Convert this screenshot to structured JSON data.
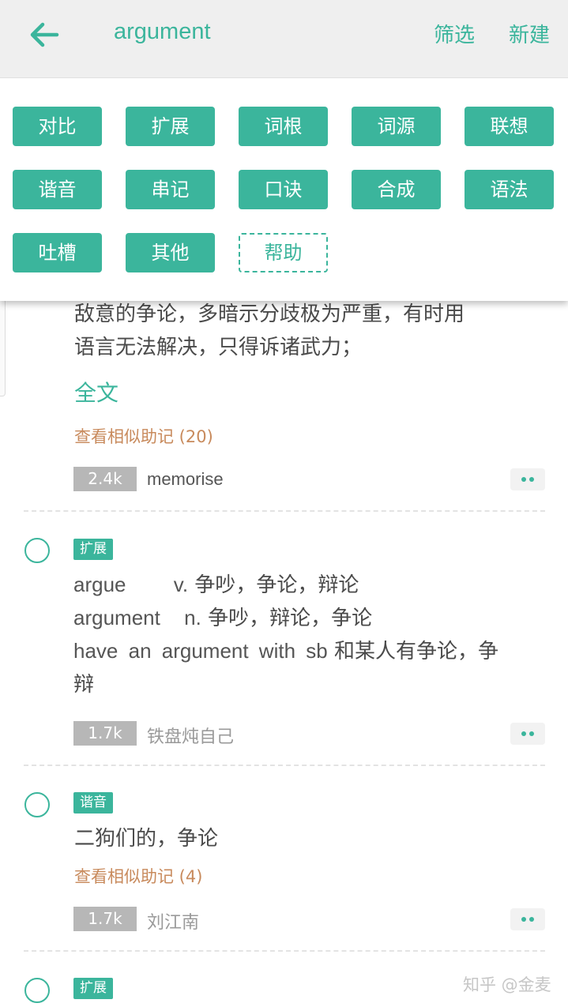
{
  "header": {
    "title": "argument",
    "filter_label": "筛选",
    "new_label": "新建",
    "back_icon": "arrow-left-icon"
  },
  "tag_popup": {
    "tags": [
      "对比",
      "扩展",
      "词根",
      "词源",
      "联想",
      "谐音",
      "串记",
      "口诀",
      "合成",
      "语法",
      "吐槽",
      "其他"
    ],
    "help_label": "帮助"
  },
  "entries": [
    {
      "lines": [
        "敌意的争论，多暗示分歧极为严重，有时用",
        "语言无法解决，只得诉诸武力；"
      ],
      "full_text_label": "全文",
      "similar_label": "查看相似助记 (20)",
      "count": "2.4k",
      "author": "memorise"
    },
    {
      "tag": "扩展",
      "lines": [
        {
          "word": "argue",
          "pos": "v.",
          "meaning": "争吵，争论，辩论"
        },
        {
          "word": "argument",
          "pos": "n.",
          "meaning": "争吵，辩论，争论"
        },
        {
          "phrase": "have an argument with sb",
          "meaning": "和某人有争论，争"
        },
        {
          "text": "辩"
        }
      ],
      "count": "1.7k",
      "author": "铁盘炖自己"
    },
    {
      "tag": "谐音",
      "text": "二狗们的，争论",
      "similar_label": "查看相似助记 (4)",
      "count": "1.7k",
      "author": "刘江南"
    },
    {
      "tag": "扩展"
    }
  ],
  "watermark": "知乎 @金麦",
  "colors": {
    "accent": "#3bb59c",
    "similar": "#c88a5c",
    "count_bg": "#b7b7b7"
  }
}
